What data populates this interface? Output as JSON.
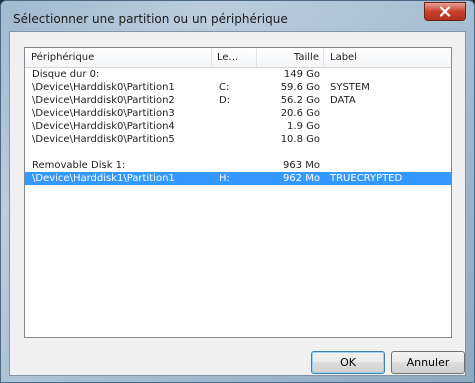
{
  "window": {
    "title": "Sélectionner une partition ou un périphérique",
    "close_icon": "close-icon"
  },
  "list": {
    "columns": [
      "Périphérique",
      "Le...",
      "Taille",
      "Label"
    ],
    "rows": [
      {
        "device": "Disque dur 0:",
        "letter": "",
        "size": "149 Go",
        "label": ""
      },
      {
        "device": "\\Device\\Harddisk0\\Partition1",
        "letter": "C:",
        "size": "59.6 Go",
        "label": "SYSTEM"
      },
      {
        "device": "\\Device\\Harddisk0\\Partition2",
        "letter": "D:",
        "size": "56.2 Go",
        "label": "DATA"
      },
      {
        "device": "\\Device\\Harddisk0\\Partition3",
        "letter": "",
        "size": "20.6 Go",
        "label": ""
      },
      {
        "device": "\\Device\\Harddisk0\\Partition4",
        "letter": "",
        "size": "1.9 Go",
        "label": ""
      },
      {
        "device": "\\Device\\Harddisk0\\Partition5",
        "letter": "",
        "size": "10.8 Go",
        "label": ""
      },
      {
        "device": "",
        "letter": "",
        "size": "",
        "label": ""
      },
      {
        "device": "Removable Disk 1:",
        "letter": "",
        "size": "963 Mo",
        "label": ""
      },
      {
        "device": "\\Device\\Harddisk1\\Partition1",
        "letter": "H:",
        "size": "962 Mo",
        "label": "TRUECRYPTED",
        "selected": true
      }
    ]
  },
  "buttons": {
    "ok": "OK",
    "cancel": "Annuler"
  },
  "colors": {
    "selection": "#3399ff",
    "close_button": "#c9412c"
  }
}
